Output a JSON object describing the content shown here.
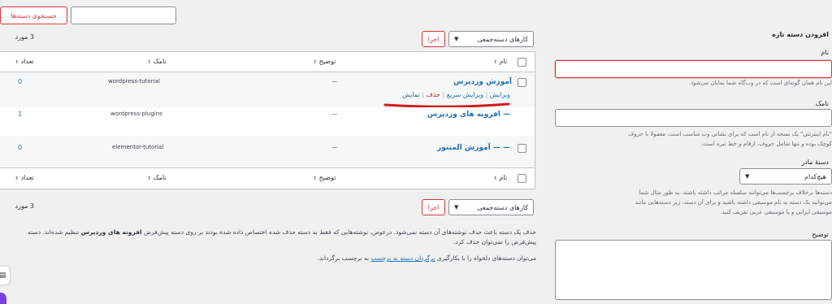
{
  "search": {
    "placeholder": "",
    "button_label": "جستجوی دسته‌ها"
  },
  "top_nav": {
    "items_count": "3 مورد"
  },
  "bulk": {
    "select_value": "کارهای دسته‌جمعی",
    "apply_label": "اجرا"
  },
  "table": {
    "headers": {
      "name": "نام",
      "description": "توضیح",
      "slug": "نامک",
      "count": "تعداد"
    },
    "rows": [
      {
        "name": "آموزش وردپرس",
        "description": "—",
        "slug": "wordpress-tutorial",
        "count": "0",
        "actions": {
          "edit": "ویرایش",
          "quick_edit": "ویرایش سریع",
          "delete": "حذف",
          "view": "نمایش"
        }
      },
      {
        "name": "— افزونه های وردپرس",
        "description": "—",
        "slug": "wordpress-plugins",
        "count": "1"
      },
      {
        "name": "— — آموزش المنتور",
        "description": "—",
        "slug": "elementor-tutorial",
        "count": "0"
      }
    ]
  },
  "bottom_nav": {
    "items_count": "3 مورد"
  },
  "notes": {
    "line1_a": "حذف یک دسته باعث حذف نوشته‌های آن دسته نمی‌شود. درعوض، نوشته‌هایی که فقط به دسته حذف شده اختصاص داده شده بودند بر روی دسته پیش‌فرض",
    "line1_b": "افزونه های وردپرس",
    "line1_c": "تنظیم شده‌اند. دسته پیش‌فرض را نمی‌توان حذف کرد.",
    "line2_a": "می‌توان دسته‌های دلخواه را با بکارگیری",
    "line2_link": "برگردان دسته به برچسب",
    "line2_b": "به برچسب برگرداند."
  },
  "add_form": {
    "title": "افزودن دسته تازه",
    "name_label": "نام",
    "name_value": "",
    "name_help": "این نام همان گونه‌ای است که در وب‌گاه شما نمایان می‌شود.",
    "slug_label": "نامک",
    "slug_value": "",
    "slug_help_1": "\"نام اینترنتی\" یک نسخه از نام است که برای نشانی وب مناسب است، معمولا با حروف",
    "slug_help_2": "کوچک بوده و تنها شامل حروف، ارقام و خط تیره است.",
    "parent_label": "دستهٔ مادر",
    "parent_value": "هیچ‌کدام",
    "parent_help_1": "دسته‌ها برخلاف برچسب‌ها می‌توانند سلسله مراتب داشته باشند، به طور مثال شما",
    "parent_help_2": "می‌توانید یک دسته به نام موسیقی داشته باشید و برای آن دسته، زیر دسته‌هایی مانند",
    "parent_help_3": "موسیقی ایرانی و یا موسیقی عربی تعریف کنید.",
    "desc_label": "توضیح",
    "desc_value": ""
  },
  "colors": {
    "link": "#2271b1",
    "danger": "#d63638",
    "annotation": "#d11a1a",
    "bg": "#f0f0f1"
  }
}
